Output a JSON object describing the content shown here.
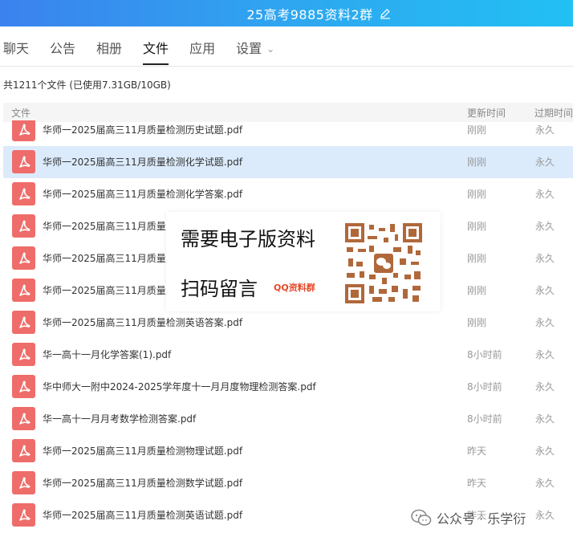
{
  "window": {
    "title": "25高考9885资料2群"
  },
  "tabs": [
    {
      "label": "聊天"
    },
    {
      "label": "公告"
    },
    {
      "label": "相册"
    },
    {
      "label": "文件",
      "active": true
    },
    {
      "label": "应用"
    },
    {
      "label": "设置",
      "has_dropdown": true
    }
  ],
  "usage": "共1211个文件 (已使用7.31GB/10GB)",
  "columns": {
    "file": "文件",
    "updated": "更新时间",
    "expire": "过期时间"
  },
  "files": [
    {
      "icon": "pdf-icon",
      "name": "华师一2025届高三11月质量检测历史试题.pdf",
      "updated": "刚刚",
      "expire": "永久"
    },
    {
      "icon": "pdf-icon",
      "name": "华师一2025届高三11月质量检测化学试题.pdf",
      "updated": "刚刚",
      "expire": "永久",
      "selected": true
    },
    {
      "icon": "pdf-icon",
      "name": "华师一2025届高三11月质量检测化学答案.pdf",
      "updated": "刚刚",
      "expire": "永久"
    },
    {
      "icon": "pdf-icon",
      "name": "华师一2025届高三11月质量检",
      "updated": "刚刚",
      "expire": "永久"
    },
    {
      "icon": "pdf-icon",
      "name": "华师一2025届高三11月质量检",
      "updated": "刚刚",
      "expire": "永久"
    },
    {
      "icon": "pdf-icon",
      "name": "华师一2025届高三11月质量检",
      "updated": "刚刚",
      "expire": "永久"
    },
    {
      "icon": "pdf-icon",
      "name": "华师一2025届高三11月质量检测英语答案.pdf",
      "updated": "刚刚",
      "expire": "永久"
    },
    {
      "icon": "pdf-icon",
      "name": "华一高十一月化学答案(1).pdf",
      "updated": "8小时前",
      "expire": "永久"
    },
    {
      "icon": "pdf-icon",
      "name": "华中师大一附中2024-2025学年度十一月月度物理检测答案.pdf",
      "updated": "8小时前",
      "expire": "永久"
    },
    {
      "icon": "pdf-icon",
      "name": "华一高十一月月考数学检测答案.pdf",
      "updated": "8小时前",
      "expire": "永久"
    },
    {
      "icon": "pdf-icon",
      "name": "华师一2025届高三11月质量检测物理试题.pdf",
      "updated": "昨天",
      "expire": "永久"
    },
    {
      "icon": "pdf-icon",
      "name": "华师一2025届高三11月质量检测数学试题.pdf",
      "updated": "昨天",
      "expire": "永久"
    },
    {
      "icon": "pdf-icon",
      "name": "华师一2025届高三11月质量检测英语试题.pdf",
      "updated": "昨天",
      "expire": "永久"
    }
  ],
  "promo": {
    "line1": "需要电子版资料",
    "line2": "扫码留言",
    "tag": "QQ资料群",
    "qr_icon": "wechat-qr-code"
  },
  "watermark": {
    "text": "公众号 · 乐学衍",
    "icon": "wechat-icon"
  },
  "colors": {
    "title_bar": "#3b82ee",
    "pdf_icon": "#ee6d6a",
    "selected_row": "#dcebfb"
  }
}
